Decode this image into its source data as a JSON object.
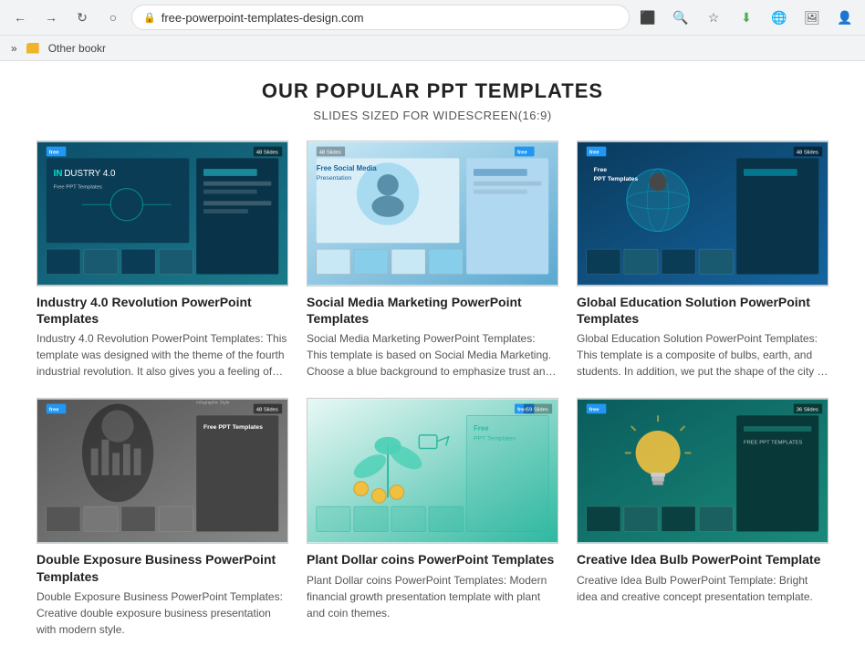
{
  "browser": {
    "url": "free-powerpoint-templates-design.com",
    "bookmarks_label": "»",
    "bookmark_folder_name": "Other bookr"
  },
  "page": {
    "title": "OUR POPULAR PPT TEMPLATES",
    "subtitle": "SLIDES SIZED FOR WIDESCREEN(16:9)"
  },
  "templates": [
    {
      "id": "industry-40",
      "name": "Industry 4.0 Revolution PowerPoint Templates",
      "description": "Industry 4.0 Revolution PowerPoint Templates: This template was designed with the theme of the fourth industrial revolution. It also gives you a feeling of being active with various...",
      "badge_free": "free",
      "badge_slides": "48 Slides",
      "thumb_type": "industry"
    },
    {
      "id": "social-media",
      "name": "Social Media Marketing PowerPoint Templates",
      "description": "Social Media Marketing PowerPoint Templates: This template is based on Social Media Marketing. Choose a blue background to emphasize trust and tidiness, and include a variety of...",
      "badge_free": "free",
      "badge_slides": "48 Slides",
      "thumb_type": "social"
    },
    {
      "id": "global-education",
      "name": "Global Education Solution PowerPoint Templates",
      "description": "Global Education Solution PowerPoint Templates: This template is a composite of bulbs, earth, and students. In addition, we put the shape of the city in the background to catch...",
      "badge_free": "free",
      "badge_slides": "48 Slides",
      "thumb_type": "education"
    },
    {
      "id": "double-exposure",
      "name": "Double Exposure Business PowerPoint Templates",
      "description": "Double Exposure Business PowerPoint Templates: Creative double exposure business presentation with modern style.",
      "badge_free": "free",
      "badge_slides": "48 Slides",
      "thumb_type": "double"
    },
    {
      "id": "plant-dollar",
      "name": "Plant Dollar coins PowerPoint Templates",
      "description": "Plant Dollar coins PowerPoint Templates: Modern financial growth presentation template with plant and coin themes.",
      "badge_free": "free",
      "badge_slides": "59 Slides",
      "thumb_type": "plant"
    },
    {
      "id": "creative-idea",
      "name": "Creative Idea Bulb PowerPoint Template",
      "description": "Creative Idea Bulb PowerPoint Template: Bright idea and creative concept presentation template.",
      "badge_free": "free",
      "badge_slides": "36 Slides",
      "thumb_type": "creative"
    }
  ]
}
